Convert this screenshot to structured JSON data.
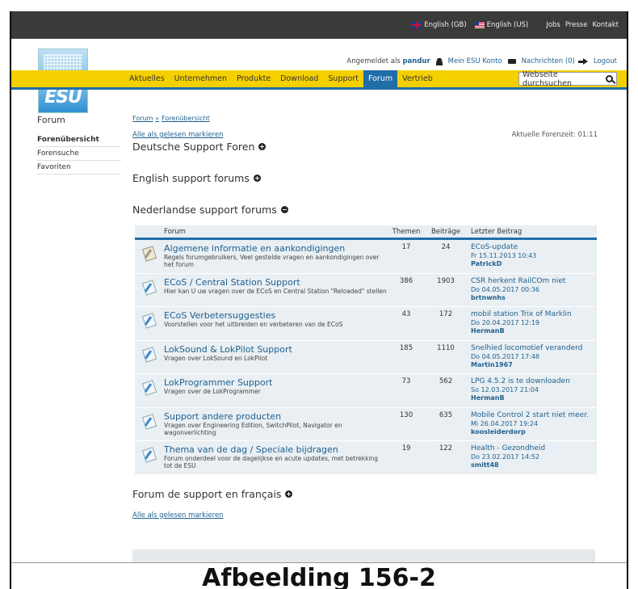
{
  "topbar": {
    "lang_gb": "English (GB)",
    "lang_us": "English (US)",
    "links": [
      "Jobs",
      "Presse",
      "Kontakt"
    ]
  },
  "logo": {
    "text": "ESU"
  },
  "userbar": {
    "logged_in_prefix": "Angemeldet als",
    "username": "pandur",
    "account": "Mein ESU Konto",
    "messages": "Nachrichten (0)",
    "logout": "Logout"
  },
  "nav": {
    "items": [
      "Aktuelles",
      "Unternehmen",
      "Produkte",
      "Download",
      "Support",
      "Forum",
      "Vertrieb"
    ],
    "active": "Forum"
  },
  "search": {
    "placeholder": "Webseite durchsuchen"
  },
  "sidebar": {
    "title": "Forum",
    "items": [
      "Forenübersicht",
      "Forensuche",
      "Favoriten"
    ]
  },
  "breadcrumb": {
    "root": "Forum",
    "sep": "»",
    "current": "Forenübersicht"
  },
  "mark_read": "Alle als gelesen markieren",
  "forum_time": "Aktuelle Forenzeit: 01:11",
  "categories": {
    "de": "Deutsche Support Foren",
    "en": "English support forums",
    "nl": "Nederlandse support forums",
    "fr": "Forum de support en français"
  },
  "table": {
    "headers": {
      "forum": "Forum",
      "themen": "Themen",
      "beitraege": "Beiträge",
      "last": "Letzter Beitrag"
    },
    "rows": [
      {
        "title": "Algemene informatie en aankondigingen",
        "desc": "Regels forumgebruikers, Veel gestelde vragen en aankondigingen over het forum",
        "themen": "17",
        "beitraege": "24",
        "last_title": "ECoS-update",
        "last_date": "Fr 15.11.2013 10:43",
        "last_user": "PatrickD"
      },
      {
        "title": "ECoS / Central Station Support",
        "desc": "Hier kan U uw vragen over de ECoS en Central Station \"Reloaded\" stellen",
        "themen": "386",
        "beitraege": "1903",
        "last_title": "CSR herkent RailCOm niet",
        "last_date": "Do 04.05.2017 00:36",
        "last_user": "brtnwnhs"
      },
      {
        "title": "ECoS Verbetersuggesties",
        "desc": "Voorstellen voor het uitbreiden en verbeteren van de ECoS",
        "themen": "43",
        "beitraege": "172",
        "last_title": "mobil station Trix of Marklin",
        "last_date": "Do 20.04.2017 12:19",
        "last_user": "HermanB"
      },
      {
        "title": "LokSound & LokPilot Support",
        "desc": "Vragen over LokSound en LokPilot",
        "themen": "185",
        "beitraege": "1110",
        "last_title": "Snelhied locomotief veranderd",
        "last_date": "Do 04.05.2017 17:48",
        "last_user": "Martin1967"
      },
      {
        "title": "LokProgrammer Support",
        "desc": "Vragen over de LokProgrammer",
        "themen": "73",
        "beitraege": "562",
        "last_title": "LPG 4.5.2 is te downloaden",
        "last_date": "So 12.03.2017 21:04",
        "last_user": "HermanB"
      },
      {
        "title": "Support andere producten",
        "desc": "Vragen over Engineering Edition, SwitchPilot, Navigator en wagonverlichting",
        "themen": "130",
        "beitraege": "635",
        "last_title": "Mobile Control 2 start niet meer.",
        "last_date": "Mi 26.04.2017 19:24",
        "last_user": "koosleiderdorp"
      },
      {
        "title": "Thema van de dag / Speciale bijdragen",
        "desc": "Forum onderdeel voor de dagelijkse en acute updates, met betrekking tot de ESU",
        "themen": "19",
        "beitraege": "122",
        "last_title": "Health - Gezondheid",
        "last_date": "Do 23.02.2017 14:52",
        "last_user": "smitt48"
      }
    ]
  },
  "caption": "Afbeelding 156-2"
}
